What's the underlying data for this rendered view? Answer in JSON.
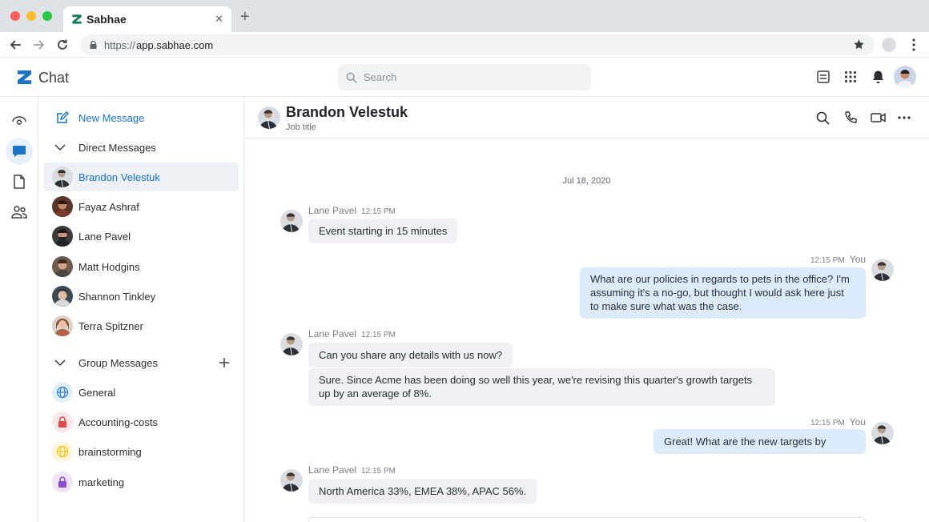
{
  "browser": {
    "tab_title": "Sabhae",
    "url_protocol": "https://",
    "url_host": "app.sabhae.com",
    "window_dots": [
      "#fe5f57",
      "#febc2e",
      "#28c840"
    ]
  },
  "app": {
    "name": "Chat",
    "brand_color": "#1a73c8",
    "search_placeholder": "Search"
  },
  "sidebar": {
    "new_message": "New Message",
    "direct_header": "Direct Messages",
    "direct": [
      {
        "name": "Brandon Velestuk",
        "active": true
      },
      {
        "name": "Fayaz Ashraf",
        "active": false
      },
      {
        "name": "Lane Pavel",
        "active": false
      },
      {
        "name": "Matt Hodgins",
        "active": false
      },
      {
        "name": "Shannon Tinkley",
        "active": false
      },
      {
        "name": "Terra Spitzner",
        "active": false
      }
    ],
    "group_header": "Group Messages",
    "groups": [
      {
        "name": "General",
        "icon": "globe-icon",
        "color": "#2f86d8",
        "bg": "#e3effb"
      },
      {
        "name": "Accounting-costs",
        "icon": "lock-icon",
        "color": "#e0484e",
        "bg": "#fde6e7"
      },
      {
        "name": "brainstorming",
        "icon": "globe-icon",
        "color": "#f0c419",
        "bg": "#fdf6da"
      },
      {
        "name": "marketing",
        "icon": "lock-icon",
        "color": "#8a4fd6",
        "bg": "#eee5fa"
      }
    ]
  },
  "conversation": {
    "name": "Brandon Velestuk",
    "subtitle": "Job title",
    "date": "Jul 18, 2020",
    "messages": [
      {
        "sender": "Lane Pavel",
        "time": "12:15 PM",
        "lines": [
          "Event starting in 15 minutes"
        ]
      },
      {
        "sender": "You",
        "time": "12:15 PM",
        "lines": [
          "What are our policies in regards to pets in the office? I'm assuming it's a no-go, but thought I would ask here just to make sure what was the case."
        ]
      },
      {
        "sender": "Lane Pavel",
        "time": "12:15 PM",
        "lines": [
          "Can you share any details with us now?",
          "Sure. Since Acme has been doing so well this year, we're revising this quarter's growth targets up by an average of 8%."
        ]
      },
      {
        "sender": "You",
        "time": "12:15 PM",
        "lines": [
          "Great! What are the new targets by"
        ]
      },
      {
        "sender": "Lane Pavel",
        "time": "12:15 PM",
        "lines": [
          "North America 33%, EMEA 38%, APAC 56%."
        ]
      }
    ]
  }
}
